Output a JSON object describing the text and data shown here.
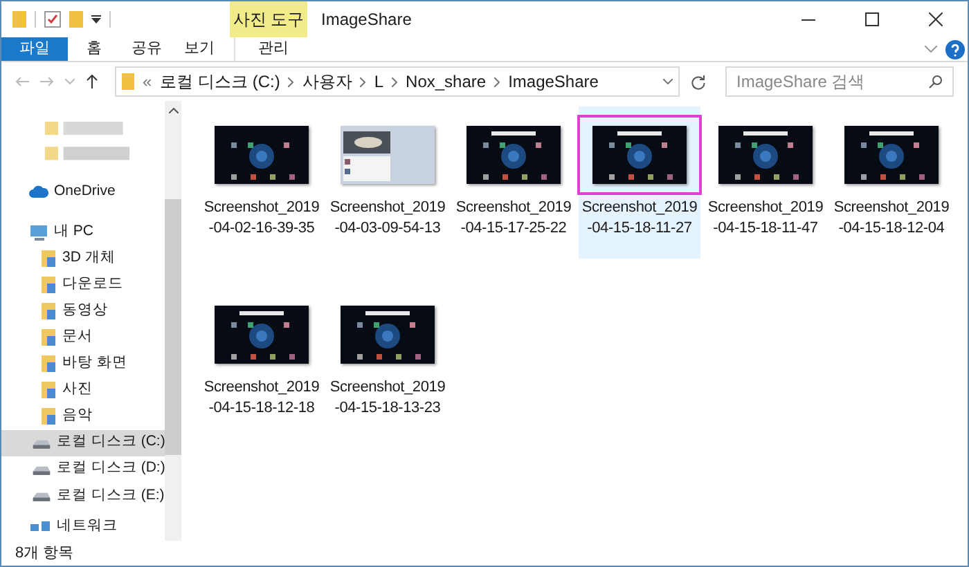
{
  "window": {
    "title": "ImageShare",
    "context_tab": "사진 도구"
  },
  "ribbon_tabs": [
    {
      "label": "파일",
      "selected": false,
      "kind": "file"
    },
    {
      "label": "홈",
      "selected": false,
      "kind": "tab"
    },
    {
      "label": "공유",
      "selected": false,
      "kind": "tab"
    },
    {
      "label": "보기",
      "selected": false,
      "kind": "tab"
    },
    {
      "label": "관리",
      "selected": false,
      "kind": "context"
    }
  ],
  "address": {
    "overflow": "«",
    "crumbs": [
      "로컬 디스크 (C:)",
      "사용자",
      "L",
      "Nox_share",
      "ImageShare"
    ]
  },
  "search": {
    "placeholder": "ImageShare 검색"
  },
  "sidebar": {
    "items": [
      {
        "label": "OneDrive",
        "kind": "cloud",
        "selected": false
      },
      {
        "label": "내 PC",
        "kind": "pc",
        "selected": false,
        "children": [
          {
            "label": "3D 개체",
            "kind": "folder",
            "selected": false
          },
          {
            "label": "다운로드",
            "kind": "folder",
            "selected": false
          },
          {
            "label": "동영상",
            "kind": "folder",
            "selected": false
          },
          {
            "label": "문서",
            "kind": "folder",
            "selected": false
          },
          {
            "label": "바탕 화면",
            "kind": "folder",
            "selected": false
          },
          {
            "label": "사진",
            "kind": "folder",
            "selected": false
          },
          {
            "label": "음악",
            "kind": "folder",
            "selected": false
          },
          {
            "label": "로컬 디스크 (C:)",
            "kind": "drive",
            "selected": true
          },
          {
            "label": "로컬 디스크 (D:)",
            "kind": "drive",
            "selected": false
          },
          {
            "label": "로컬 디스크 (E:)",
            "kind": "drive",
            "selected": false
          }
        ]
      },
      {
        "label": "네트워크",
        "kind": "network",
        "selected": false
      }
    ]
  },
  "files": [
    {
      "name": "Screenshot_2019\n-04-02-16-39-35",
      "selected": false,
      "outlined": false
    },
    {
      "name": "Screenshot_2019\n-04-03-09-54-13",
      "selected": false,
      "outlined": false
    },
    {
      "name": "Screenshot_2019\n-04-15-17-25-22",
      "selected": false,
      "outlined": false
    },
    {
      "name": "Screenshot_2019\n-04-15-18-11-27",
      "selected": true,
      "outlined": true
    },
    {
      "name": "Screenshot_2019\n-04-15-18-11-47",
      "selected": false,
      "outlined": false
    },
    {
      "name": "Screenshot_2019\n-04-15-18-12-04",
      "selected": false,
      "outlined": false
    },
    {
      "name": "Screenshot_2019\n-04-15-18-12-18",
      "selected": false,
      "outlined": false
    },
    {
      "name": "Screenshot_2019\n-04-15-18-13-23",
      "selected": false,
      "outlined": false
    }
  ],
  "status_bar": {
    "count": "8개 항목"
  }
}
